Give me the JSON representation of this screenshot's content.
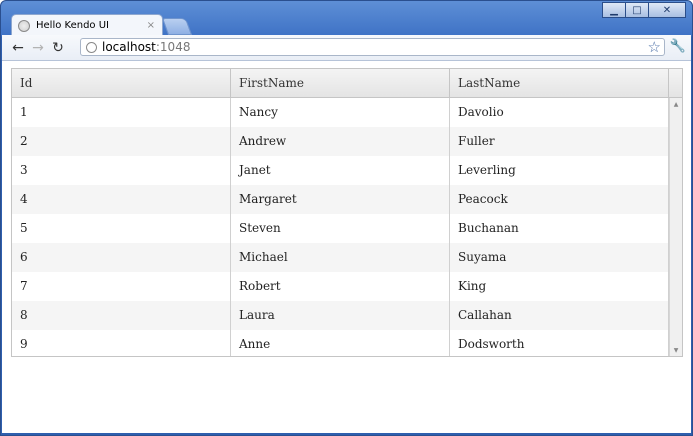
{
  "browser": {
    "tab_title": "Hello Kendo UI",
    "tab_close": "×",
    "url_host": "localhost",
    "url_port": ":1048"
  },
  "window_controls": {
    "minimize": "▁",
    "maximize": "□",
    "close": "✕"
  },
  "grid": {
    "columns": [
      "Id",
      "FirstName",
      "LastName"
    ],
    "rows": [
      {
        "id": "1",
        "first": "Nancy",
        "last": "Davolio"
      },
      {
        "id": "2",
        "first": "Andrew",
        "last": "Fuller"
      },
      {
        "id": "3",
        "first": "Janet",
        "last": "Leverling"
      },
      {
        "id": "4",
        "first": "Margaret",
        "last": "Peacock"
      },
      {
        "id": "5",
        "first": "Steven",
        "last": "Buchanan"
      },
      {
        "id": "6",
        "first": "Michael",
        "last": "Suyama"
      },
      {
        "id": "7",
        "first": "Robert",
        "last": "King"
      },
      {
        "id": "8",
        "first": "Laura",
        "last": "Callahan"
      },
      {
        "id": "9",
        "first": "Anne",
        "last": "Dodsworth"
      }
    ]
  }
}
